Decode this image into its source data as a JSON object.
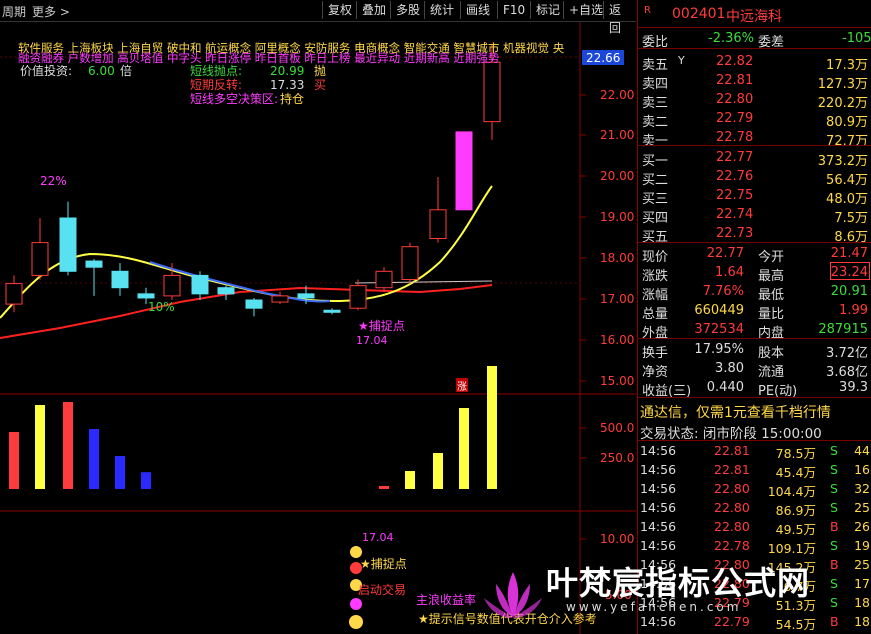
{
  "topbar": {
    "left_label1": "周期",
    "left_label2": "更多 >",
    "buttons": [
      "复权",
      "叠加",
      "多股",
      "统计",
      "画线",
      "F10",
      "标记",
      "+自选",
      "返回"
    ]
  },
  "kline": {
    "concepts_line1": "软件服务  上海板块  上海自贸 破中和 航运概念 阿里概念 安防服务 电商概念 智能交通 智慧城市 机器视觉 央",
    "concepts_line2": "融资融券 户数增加 高贝塔值 中字头 昨日涨停 昨日首板 昨日上榜 最近异动 近期新高 近期强势",
    "value_label": "价值投资:",
    "value_num": "6.00",
    "value_unit": "倍",
    "short_sell_label": "短线抛点:",
    "short_sell_val": "20.99",
    "short_sell_act": "抛",
    "short_rebound_label": "短期反转:",
    "short_rebound_val": "17.33",
    "short_rebound_act": "买",
    "decision_label": "短线多空决策区:",
    "decision_val": "持仓",
    "pct_top": "22%",
    "pct_bottom": "10%",
    "catch_label": "★捕捉点",
    "catch_price": "17.04",
    "price_tag": "22.66",
    "axis": [
      "22.00",
      "21.00",
      "20.00",
      "19.00",
      "18.00",
      "17.00",
      "16.00",
      "15.00"
    ],
    "zhang_mark": "涨"
  },
  "volume": {
    "axis": [
      "500.0",
      "250.0"
    ]
  },
  "indicator": {
    "axis": [
      "10.00",
      "5.00"
    ],
    "price": "17.04",
    "catch": "★捕捉点",
    "start": "启动交易",
    "profit": "主浪收益率",
    "hint": "★提示信号数值代表开仓介入参考"
  },
  "quote": {
    "code": "002401",
    "name": "中远海科",
    "r_mark": "R",
    "weibi_label": "委比",
    "weibi_val": "-2.36%",
    "weicha_label": "委差",
    "weicha_val": "-105",
    "asks": [
      {
        "label": "卖五",
        "mark": "Y",
        "price": "22.82",
        "vol": "17.3万"
      },
      {
        "label": "卖四",
        "price": "22.81",
        "vol": "127.3万"
      },
      {
        "label": "卖三",
        "price": "22.80",
        "vol": "220.2万"
      },
      {
        "label": "卖二",
        "price": "22.79",
        "vol": "80.9万"
      },
      {
        "label": "卖一",
        "price": "22.78",
        "vol": "72.7万"
      }
    ],
    "bids": [
      {
        "label": "买一",
        "price": "22.77",
        "vol": "373.2万"
      },
      {
        "label": "买二",
        "price": "22.76",
        "vol": "56.4万"
      },
      {
        "label": "买三",
        "price": "22.75",
        "vol": "48.0万"
      },
      {
        "label": "买四",
        "price": "22.74",
        "vol": "7.5万"
      },
      {
        "label": "买五",
        "price": "22.73",
        "vol": "8.6万"
      }
    ],
    "stats": [
      {
        "l1": "现价",
        "v1": "22.77",
        "l2": "今开",
        "v2": "21.47"
      },
      {
        "l1": "涨跌",
        "v1": "1.64",
        "l2": "最高",
        "v2": "23.24"
      },
      {
        "l1": "涨幅",
        "v1": "7.76%",
        "l2": "最低",
        "v2": "20.91"
      },
      {
        "l1": "总量",
        "v1": "660449",
        "l2": "量比",
        "v2": "1.99"
      },
      {
        "l1": "外盘",
        "v1": "372534",
        "l2": "内盘",
        "v2": "287915"
      }
    ],
    "stats2": [
      {
        "l1": "换手",
        "v1": "17.95%",
        "l2": "股本",
        "v2": "3.72亿"
      },
      {
        "l1": "净资",
        "v1": "3.80",
        "l2": "流通",
        "v2": "3.68亿"
      },
      {
        "l1": "收益(三)",
        "v1": "0.440",
        "l2": "PE(动)",
        "v2": "39.3"
      }
    ],
    "promo": "通达信，仅需1元查看千档行情",
    "trade_status": "交易状态: 闭市阶段 15:00:00",
    "ticks": [
      {
        "time": "14:56",
        "price": "22.81",
        "vol": "78.5万",
        "dir": "S",
        "n": "44"
      },
      {
        "time": "14:56",
        "price": "22.81",
        "vol": "45.4万",
        "dir": "S",
        "n": "16"
      },
      {
        "time": "14:56",
        "price": "22.80",
        "vol": "104.4万",
        "dir": "S",
        "n": "32"
      },
      {
        "time": "14:56",
        "price": "22.80",
        "vol": "86.9万",
        "dir": "S",
        "n": "25"
      },
      {
        "time": "14:56",
        "price": "22.80",
        "vol": "49.5万",
        "dir": "B",
        "n": "26"
      },
      {
        "time": "14:56",
        "price": "22.78",
        "vol": "109.1万",
        "dir": "S",
        "n": "19"
      },
      {
        "time": "14:56",
        "price": "22.80",
        "vol": "145.2万",
        "dir": "B",
        "n": "25"
      },
      {
        "time": "14:56",
        "price": "22.80",
        "vol": "6.7万",
        "dir": "S",
        "n": "17"
      },
      {
        "time": "14:56",
        "price": "22.79",
        "vol": "51.3万",
        "dir": "S",
        "n": "18"
      },
      {
        "time": "14:56",
        "price": "22.79",
        "vol": "54.5万",
        "dir": "B",
        "n": "18"
      }
    ]
  },
  "watermark": {
    "title": "叶梵宸指标公式网",
    "url": "www.yefanchen.com"
  },
  "colors": {
    "up": "#ff3b3b",
    "down": "#58e1f0",
    "ma5": "#ffff44",
    "ma_long": "#ff2020",
    "magenta": "#ff3bff"
  }
}
